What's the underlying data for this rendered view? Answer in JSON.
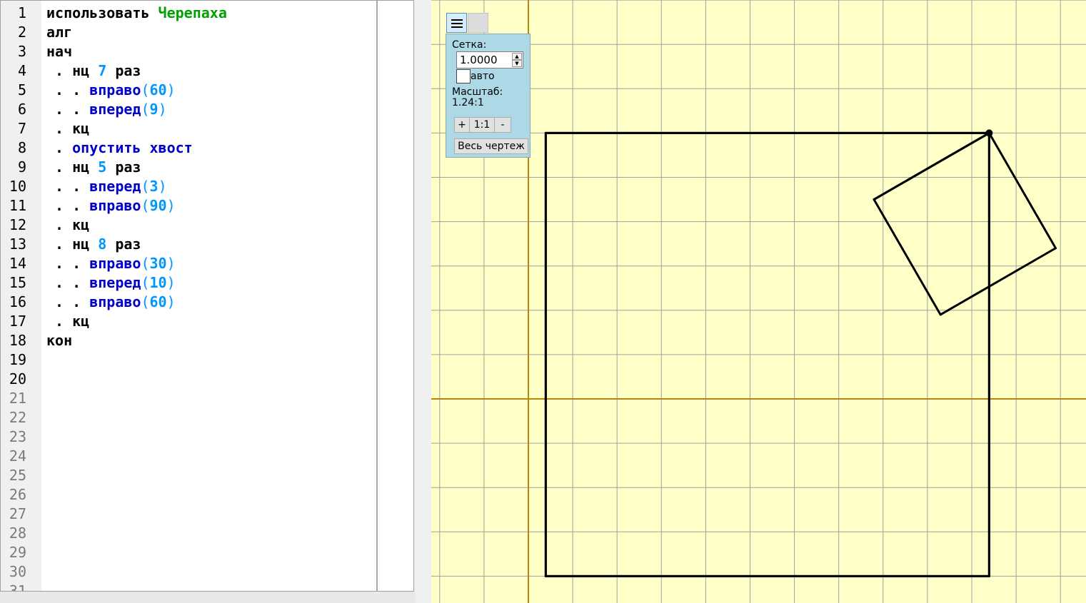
{
  "editor": {
    "line_numbers": [
      "1",
      "2",
      "3",
      "4",
      "5",
      "6",
      "7",
      "8",
      "9",
      "10",
      "11",
      "12",
      "13",
      "14",
      "15",
      "16",
      "17",
      "18",
      "19",
      "20",
      "21",
      "22",
      "23",
      "24",
      "25",
      "26",
      "27",
      "28",
      "29",
      "30",
      "31"
    ],
    "lines": [
      [
        {
          "t": "использовать ",
          "c": "kw"
        },
        {
          "t": "Черепаха",
          "c": "mod"
        }
      ],
      [
        {
          "t": "алг",
          "c": "kw"
        }
      ],
      [
        {
          "t": "нач",
          "c": "kw"
        }
      ],
      [
        {
          "t": " . ",
          "c": "dot"
        },
        {
          "t": "нц ",
          "c": "kw"
        },
        {
          "t": "7",
          "c": "num"
        },
        {
          "t": " раз",
          "c": "kw"
        }
      ],
      [
        {
          "t": " . . ",
          "c": "dot"
        },
        {
          "t": "вправо",
          "c": "cmd"
        },
        {
          "t": "(",
          "c": "paren"
        },
        {
          "t": "60",
          "c": "num"
        },
        {
          "t": ")",
          "c": "paren"
        }
      ],
      [
        {
          "t": " . . ",
          "c": "dot"
        },
        {
          "t": "вперед",
          "c": "cmd"
        },
        {
          "t": "(",
          "c": "paren"
        },
        {
          "t": "9",
          "c": "num"
        },
        {
          "t": ")",
          "c": "paren"
        }
      ],
      [
        {
          "t": " . ",
          "c": "dot"
        },
        {
          "t": "кц",
          "c": "kw"
        }
      ],
      [
        {
          "t": " . ",
          "c": "dot"
        },
        {
          "t": "опустить хвост",
          "c": "cmd"
        }
      ],
      [
        {
          "t": " . ",
          "c": "dot"
        },
        {
          "t": "нц ",
          "c": "kw"
        },
        {
          "t": "5",
          "c": "num"
        },
        {
          "t": " раз",
          "c": "kw"
        }
      ],
      [
        {
          "t": " . . ",
          "c": "dot"
        },
        {
          "t": "вперед",
          "c": "cmd"
        },
        {
          "t": "(",
          "c": "paren"
        },
        {
          "t": "3",
          "c": "num"
        },
        {
          "t": ")",
          "c": "paren"
        }
      ],
      [
        {
          "t": " . . ",
          "c": "dot"
        },
        {
          "t": "вправо",
          "c": "cmd"
        },
        {
          "t": "(",
          "c": "paren"
        },
        {
          "t": "90",
          "c": "num"
        },
        {
          "t": ")",
          "c": "paren"
        }
      ],
      [
        {
          "t": " . ",
          "c": "dot"
        },
        {
          "t": "кц",
          "c": "kw"
        }
      ],
      [
        {
          "t": " . ",
          "c": "dot"
        },
        {
          "t": "нц ",
          "c": "kw"
        },
        {
          "t": "8",
          "c": "num"
        },
        {
          "t": " раз",
          "c": "kw"
        }
      ],
      [
        {
          "t": " . . ",
          "c": "dot"
        },
        {
          "t": "вправо",
          "c": "cmd"
        },
        {
          "t": "(",
          "c": "paren"
        },
        {
          "t": "30",
          "c": "num"
        },
        {
          "t": ")",
          "c": "paren"
        }
      ],
      [
        {
          "t": " . . ",
          "c": "dot"
        },
        {
          "t": "вперед",
          "c": "cmd"
        },
        {
          "t": "(",
          "c": "paren"
        },
        {
          "t": "10",
          "c": "num"
        },
        {
          "t": ")",
          "c": "paren"
        }
      ],
      [
        {
          "t": " . . ",
          "c": "dot"
        },
        {
          "t": "вправо",
          "c": "cmd"
        },
        {
          "t": "(",
          "c": "paren"
        },
        {
          "t": "60",
          "c": "num"
        },
        {
          "t": ")",
          "c": "paren"
        }
      ],
      [
        {
          "t": " . ",
          "c": "dot"
        },
        {
          "t": "кц",
          "c": "kw"
        }
      ],
      [
        {
          "t": "кон",
          "c": "kw"
        }
      ]
    ],
    "active_line_count": 20
  },
  "grid_panel": {
    "grid_label": "Сетка:",
    "grid_step": "1.0000",
    "auto_label": "авто",
    "auto_checked": false,
    "scale_label": "Масштаб:",
    "scale_value": "1.24:1",
    "zoom_in_label": "+",
    "zoom_reset_label": "1:1",
    "zoom_out_label": "-",
    "fit_all_label": "Весь чертеж"
  },
  "drawing": {
    "grid_step_units": 1,
    "origin_axis_color": "#b8860b",
    "grid_color": "#a0a0a0",
    "background_color": "#ffffc8",
    "turtle_visible": true
  },
  "colors": {
    "keyword": "#000000",
    "command": "#0000c8",
    "number": "#0096ff",
    "module": "#00a000",
    "panel": "#add8e6"
  }
}
